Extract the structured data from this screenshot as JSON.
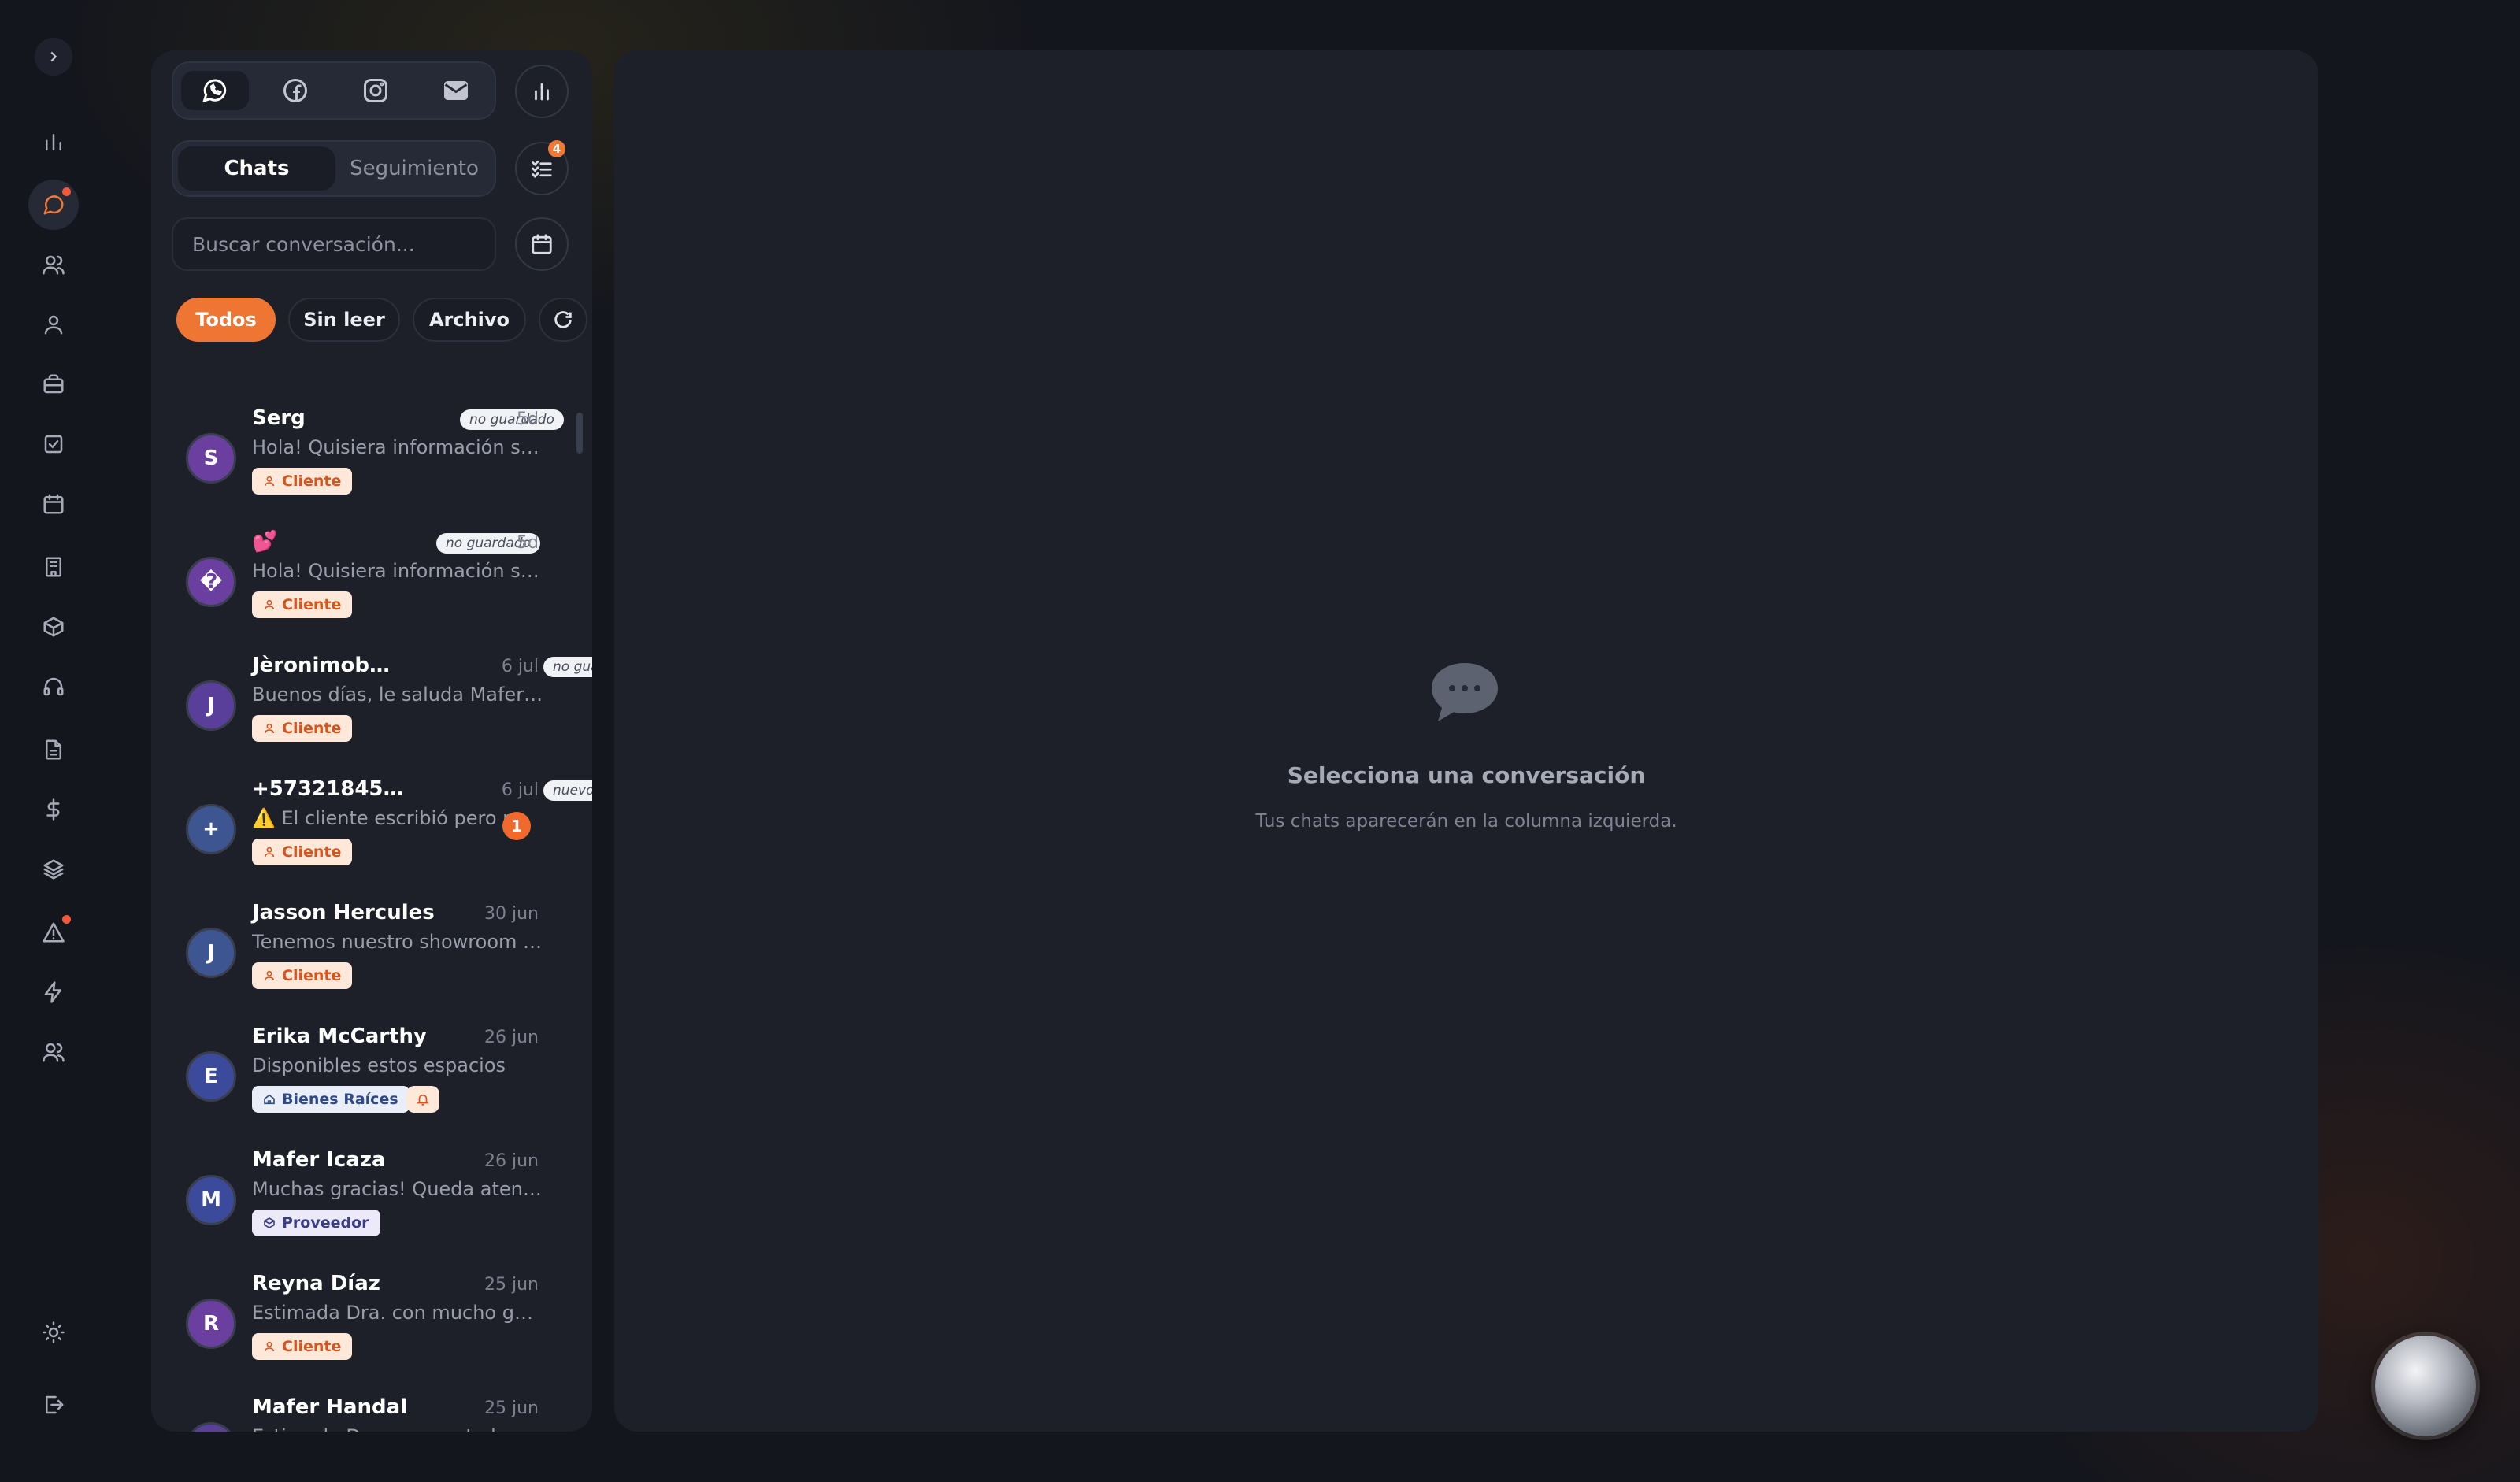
{
  "channels": [
    {
      "name": "whatsapp",
      "active": true
    },
    {
      "name": "facebook",
      "active": false
    },
    {
      "name": "instagram",
      "active": false
    },
    {
      "name": "email",
      "active": false
    }
  ],
  "tasks_badge": "4",
  "tabs": [
    {
      "label": "Chats",
      "active": true
    },
    {
      "label": "Seguimiento",
      "active": false
    }
  ],
  "search": {
    "placeholder": "Buscar conversación...",
    "value": ""
  },
  "filters": [
    {
      "label": "Todos",
      "active": true
    },
    {
      "label": "Sin leer",
      "active": false
    },
    {
      "label": "Archivo",
      "active": false
    }
  ],
  "chats": [
    {
      "name": "Serg",
      "status_tag": "no guardado",
      "time": "5d",
      "preview": "Hola! Quisiera información sobre",
      "avatar": "S",
      "avatar_color": "#6b3fa0",
      "label": "Cliente",
      "label_type": "cliente"
    },
    {
      "name": "💕",
      "status_tag": "no guardado",
      "time": "5d",
      "preview": "Hola! Quisiera información sobre",
      "avatar": "�",
      "avatar_color": "#6b3fa0",
      "label": "Cliente",
      "label_type": "cliente"
    },
    {
      "name": "Jèronimob…",
      "status_tag": "no guardado",
      "time": "6 jul",
      "preview": "Buenos días, le saluda Mafer Handal",
      "avatar": "J",
      "avatar_color": "#5a3f9a",
      "label": "Cliente",
      "label_type": "cliente"
    },
    {
      "name": "+57321845…",
      "status_tag": "nuevo",
      "time": "6 jul",
      "preview": "⚠️ El cliente escribió pero no",
      "avatar": "+",
      "avatar_color": "#3d5590",
      "label": "Cliente",
      "label_type": "cliente",
      "unread": "1"
    },
    {
      "name": "Jasson Hercules",
      "time": "30 jun",
      "preview": "Tenemos nuestro showroom disponible",
      "avatar": "J",
      "avatar_color": "#3d5590",
      "label": "Cliente",
      "label_type": "cliente"
    },
    {
      "name": "Erika McCarthy",
      "time": "26 jun",
      "preview": "Disponibles estos espacios",
      "avatar": "E",
      "avatar_color": "#3b4a9a",
      "label": "Bienes Raíces",
      "label_type": "bienes",
      "bell": true
    },
    {
      "name": "Mafer Icaza",
      "time": "26 jun",
      "preview": "Muchas gracias! Queda atenta a",
      "avatar": "M",
      "avatar_color": "#3b4a9a",
      "label": "Proveedor",
      "label_type": "proveedor"
    },
    {
      "name": "Reyna Díaz",
      "time": "25 jun",
      "preview": "Estimada Dra. con mucho gusto le",
      "avatar": "R",
      "avatar_color": "#6b3fa0",
      "label": "Cliente",
      "label_type": "cliente"
    },
    {
      "name": "Mafer Handal",
      "time": "25 jun",
      "preview": "Estimada Dra. con gusto le explico",
      "avatar": "M",
      "avatar_color": "#5a3f9a",
      "label": "",
      "label_type": ""
    }
  ],
  "empty_state": {
    "title": "Selecciona una conversación",
    "subtitle": "Tus chats aparecerán en la columna izquierda."
  },
  "colors": {
    "accent": "#ef7632",
    "panel": "#1d2029",
    "background": "#14161d"
  }
}
